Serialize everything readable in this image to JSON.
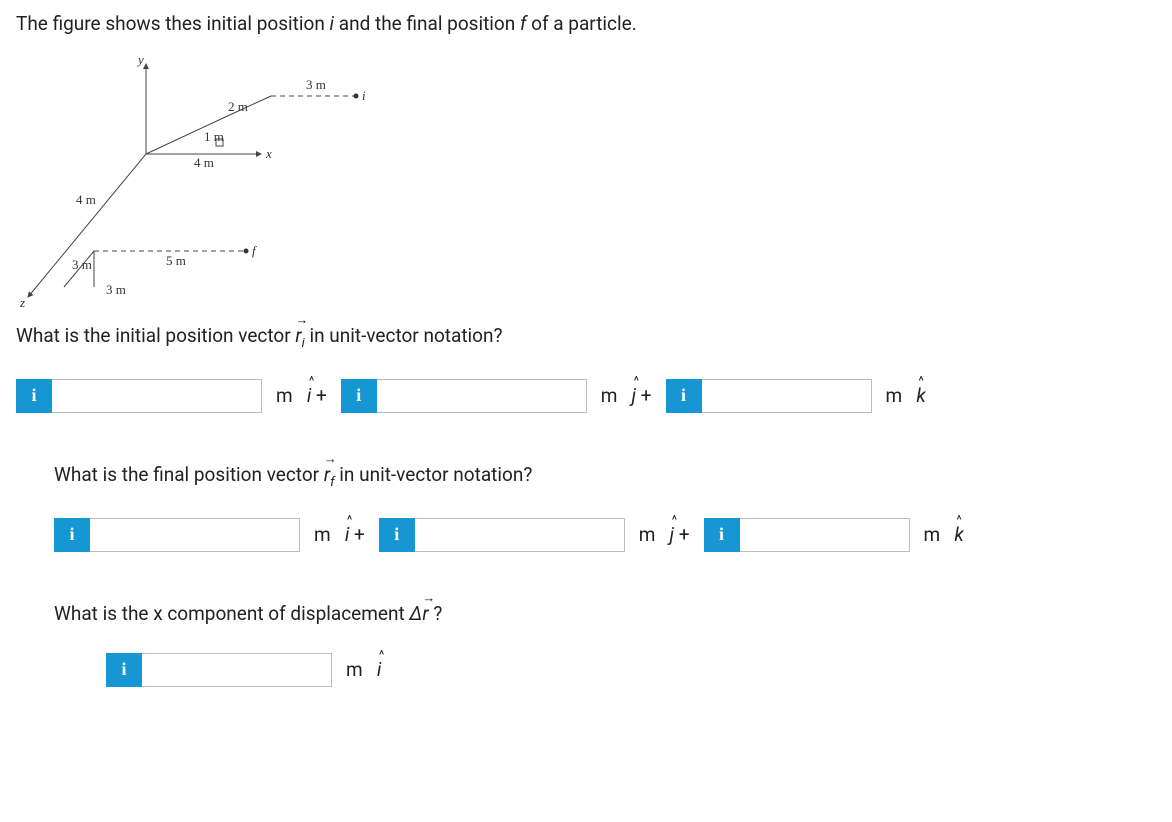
{
  "intro": {
    "pre": "The figure shows thes initial position ",
    "i": "i",
    "mid": " and the final position ",
    "f": "f",
    "post": " of a particle."
  },
  "figure": {
    "labels": {
      "y": "y",
      "x": "x",
      "z": "z",
      "i": "i",
      "f": "f",
      "m3_top": "3 m",
      "m2": "2 m",
      "m1": "1 m",
      "m4_axis": "4 m",
      "m4_diag": "4 m",
      "m3_left": "3 m",
      "m5": "5 m",
      "m3_bottom": "3 m"
    }
  },
  "q1": {
    "pre": "What is the initial position vector ",
    "sym": "r",
    "sub": "i",
    "post": " in unit-vector notation?"
  },
  "q2": {
    "pre": "What is the final position vector ",
    "sym": "r",
    "sub": "f",
    "post": " in unit-vector notation?"
  },
  "q3": {
    "pre": "What is the x component of displacement ",
    "delta": "Δ",
    "sym": "r",
    "post": " ?"
  },
  "units": {
    "m_i_plus_pre": "m   ",
    "m_j_plus_pre": "m   ",
    "m_k_pre": "m   ",
    "m_i_single_pre": "m   ",
    "i": "i",
    "j": "j",
    "k": "k",
    "plus": " +"
  },
  "btn": {
    "info": "i"
  },
  "inputs": {
    "ri_x": "",
    "ri_y": "",
    "ri_z": "",
    "rf_x": "",
    "rf_y": "",
    "rf_z": "",
    "dx": ""
  }
}
